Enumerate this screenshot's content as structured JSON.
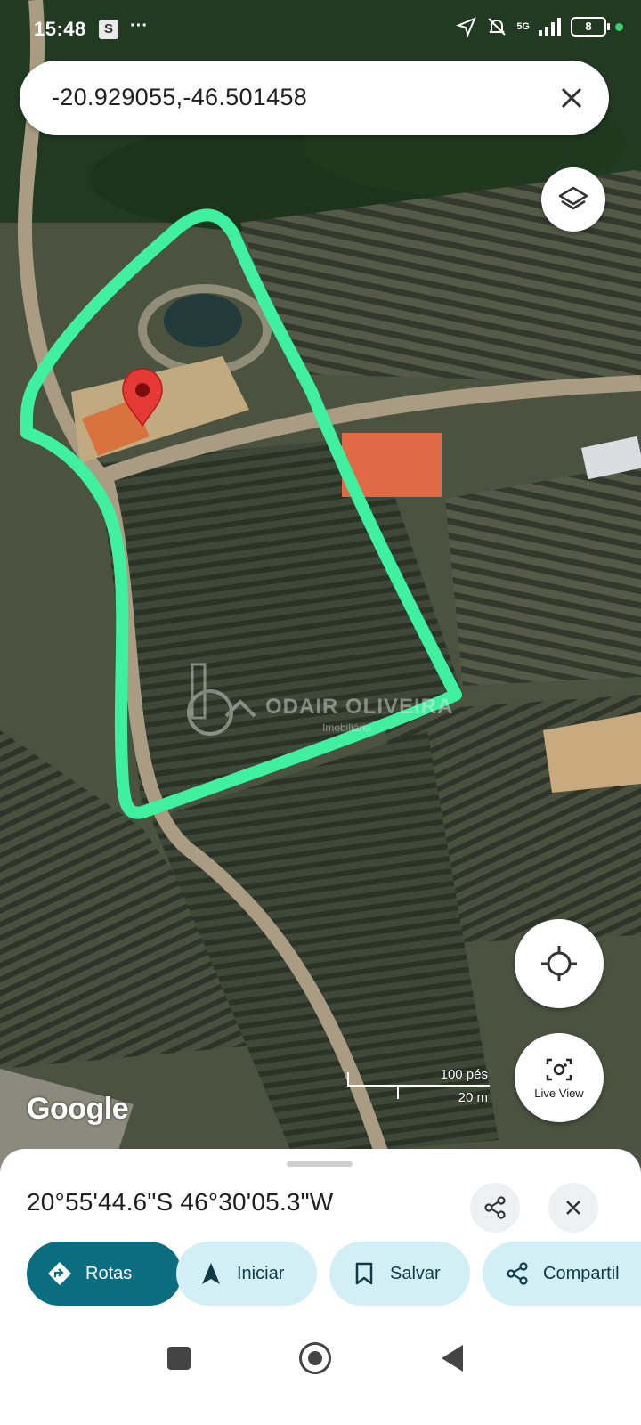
{
  "status_bar": {
    "time": "15:48",
    "app_badge": "S",
    "more": "···",
    "network": "5G",
    "battery": "8"
  },
  "search": {
    "query": "-20.929055,-46.501458",
    "clear_icon": "close-icon"
  },
  "map": {
    "layers_icon": "layers-icon",
    "my_location_icon": "my-location-icon",
    "live_view_label": "Live View",
    "scale_imperial": "100 pés",
    "scale_metric": "20 m",
    "attribution": "Google",
    "watermark_title": "ODAIR OLIVEIRA",
    "watermark_sub": "Imobiliária",
    "pin_color": "#e53935",
    "outline_color": "#3ff0a0"
  },
  "place_sheet": {
    "coordinates": "20°55'44.6\"S 46°30'05.3\"W",
    "actions": [
      {
        "label": "Rotas",
        "icon": "directions-icon",
        "style": "primary"
      },
      {
        "label": "Iniciar",
        "icon": "navigation-arrow-icon",
        "style": "secondary"
      },
      {
        "label": "Salvar",
        "icon": "bookmark-icon",
        "style": "secondary"
      },
      {
        "label": "Compartil",
        "icon": "share-icon",
        "style": "secondary"
      }
    ],
    "accent_color": "#0b6e80"
  }
}
